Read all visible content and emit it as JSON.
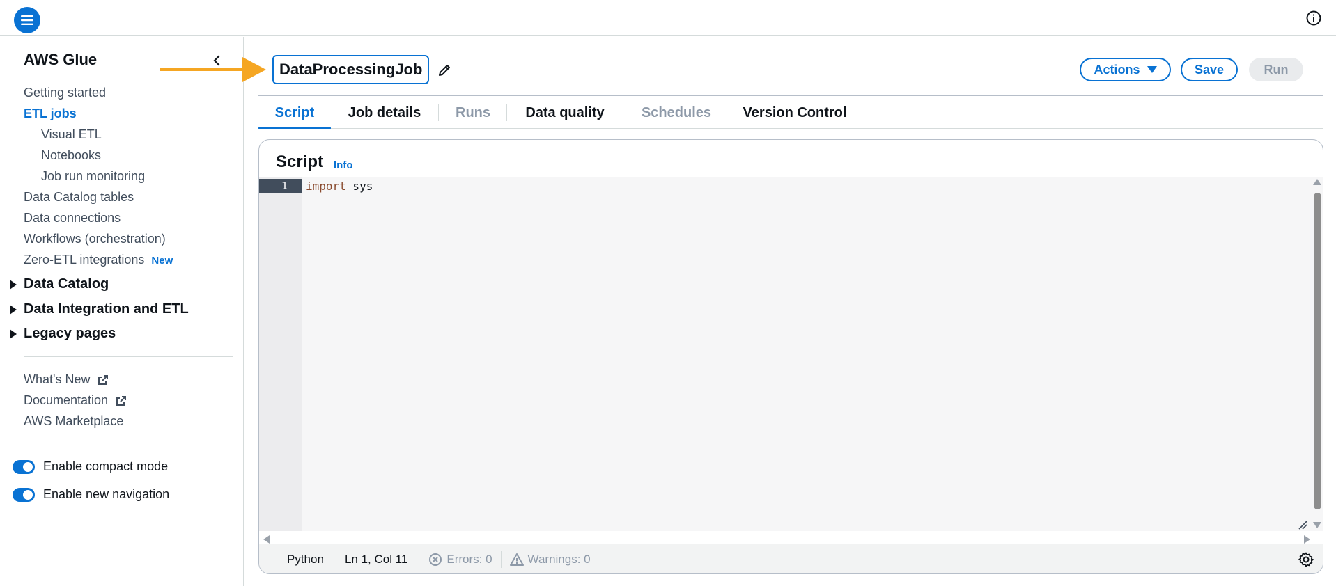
{
  "topbar": {
    "menu_icon": "hamburger-menu-icon",
    "info_icon": "info-icon"
  },
  "sidebar": {
    "title": "AWS Glue",
    "collapse_icon": "chevron-left-icon",
    "links": [
      {
        "label": "Getting started"
      },
      {
        "label": "ETL jobs",
        "active": true
      },
      {
        "label": "Visual ETL"
      },
      {
        "label": "Notebooks"
      },
      {
        "label": "Job run monitoring"
      },
      {
        "label": "Data Catalog tables"
      },
      {
        "label": "Data connections"
      },
      {
        "label": "Workflows (orchestration)"
      },
      {
        "label": "Zero-ETL integrations",
        "badge": "New"
      }
    ],
    "sections": [
      {
        "label": "Data Catalog"
      },
      {
        "label": "Data Integration and ETL"
      },
      {
        "label": "Legacy pages"
      }
    ],
    "footer_links": [
      {
        "label": "What's New",
        "external": true
      },
      {
        "label": "Documentation",
        "external": true
      },
      {
        "label": "AWS Marketplace"
      }
    ],
    "toggles": [
      {
        "label": "Enable compact mode",
        "on": true
      },
      {
        "label": "Enable new navigation",
        "on": true
      }
    ]
  },
  "header": {
    "job_name": "DataProcessingJob",
    "edit_icon": "pencil-icon",
    "actions_label": "Actions",
    "save_label": "Save",
    "run_label": "Run"
  },
  "tabs": [
    {
      "label": "Script",
      "state": "active"
    },
    {
      "label": "Job details",
      "state": "enabled"
    },
    {
      "label": "Runs",
      "state": "disabled"
    },
    {
      "label": "Data quality",
      "state": "enabled"
    },
    {
      "label": "Schedules",
      "state": "disabled"
    },
    {
      "label": "Version Control",
      "state": "enabled"
    }
  ],
  "script_panel": {
    "title": "Script",
    "info_label": "Info",
    "editor": {
      "line_number": "1",
      "keyword": "import",
      "code_rest": " sys"
    },
    "status": {
      "language": "Python",
      "position": "Ln 1, Col 11",
      "errors": "Errors: 0",
      "warnings": "Warnings: 0",
      "settings_icon": "gear-icon"
    }
  },
  "colors": {
    "accent": "#0972d3",
    "annotation_arrow": "#f5a623",
    "disabled_text": "#8d99a8"
  }
}
